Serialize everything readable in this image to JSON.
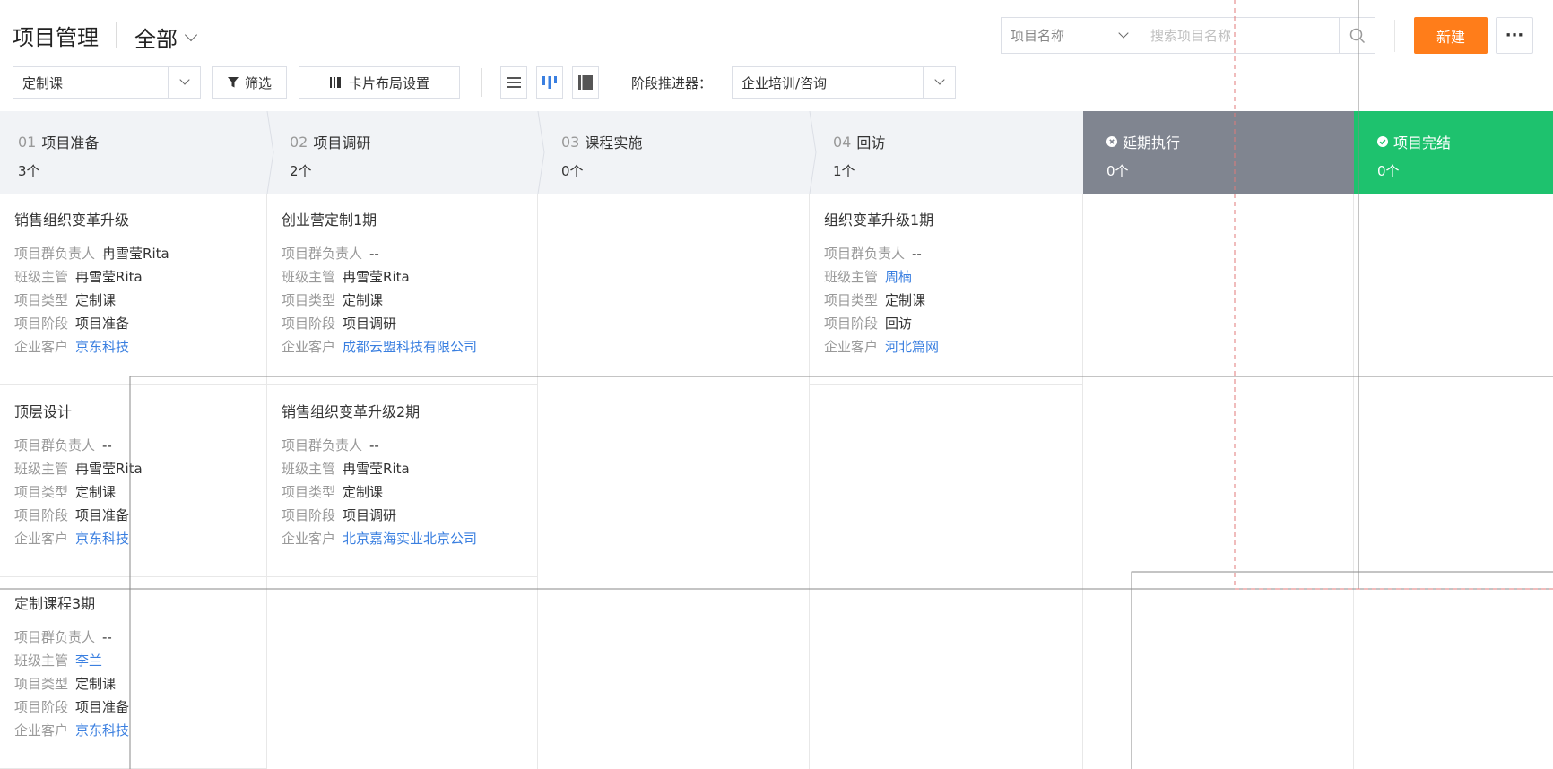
{
  "header": {
    "title": "项目管理",
    "scope": "全部",
    "search_category": "项目名称",
    "search_placeholder": "搜索项目名称",
    "new_label": "新建",
    "more_label": "···"
  },
  "toolbar": {
    "course_select": "定制课",
    "filter_label": "筛选",
    "layout_label": "卡片布局设置",
    "stage_advancer_label": "阶段推进器：",
    "stage_advancer_value": "企业培训/咨询"
  },
  "stages": [
    {
      "num": "01",
      "name": "项目准备",
      "count": "3个"
    },
    {
      "num": "02",
      "name": "项目调研",
      "count": "2个"
    },
    {
      "num": "03",
      "name": "课程实施",
      "count": "0个"
    },
    {
      "num": "04",
      "name": "回访",
      "count": "1个"
    },
    {
      "num": "",
      "name": "延期执行",
      "count": "0个"
    },
    {
      "num": "",
      "name": "项目完结",
      "count": "0个"
    }
  ],
  "labels": {
    "owner": "项目群负责人",
    "supervisor": "班级主管",
    "type": "项目类型",
    "phase": "项目阶段",
    "client": "企业客户"
  },
  "cards": {
    "col0": [
      {
        "title": "销售组织变革升级",
        "owner": "冉雪莹Rita",
        "supervisor": "冉雪莹Rita",
        "type": "定制课",
        "phase": "项目准备",
        "client": "京东科技"
      },
      {
        "title": "顶层设计",
        "owner": "--",
        "supervisor": "冉雪莹Rita",
        "type": "定制课",
        "phase": "项目准备",
        "client": "京东科技"
      },
      {
        "title": "定制课程3期",
        "owner": "--",
        "supervisor": "李兰",
        "type": "定制课",
        "phase": "项目准备",
        "client": "京东科技"
      }
    ],
    "col1": [
      {
        "title": "创业营定制1期",
        "owner": "--",
        "supervisor": "冉雪莹Rita",
        "type": "定制课",
        "phase": "项目调研",
        "client": "成都云盟科技有限公司"
      },
      {
        "title": "销售组织变革升级2期",
        "owner": "--",
        "supervisor": "冉雪莹Rita",
        "type": "定制课",
        "phase": "项目调研",
        "client": "北京嘉海实业北京公司"
      }
    ],
    "col3": [
      {
        "title": "组织变革升级1期",
        "owner": "--",
        "supervisor": "周楠",
        "type": "定制课",
        "phase": "回访",
        "client": "河北篇网"
      }
    ]
  },
  "colors": {
    "accent_orange": "#ff7d1a",
    "stage_delay": "#808590",
    "stage_done": "#1ec26e",
    "link_blue": "#3a7fe0"
  }
}
